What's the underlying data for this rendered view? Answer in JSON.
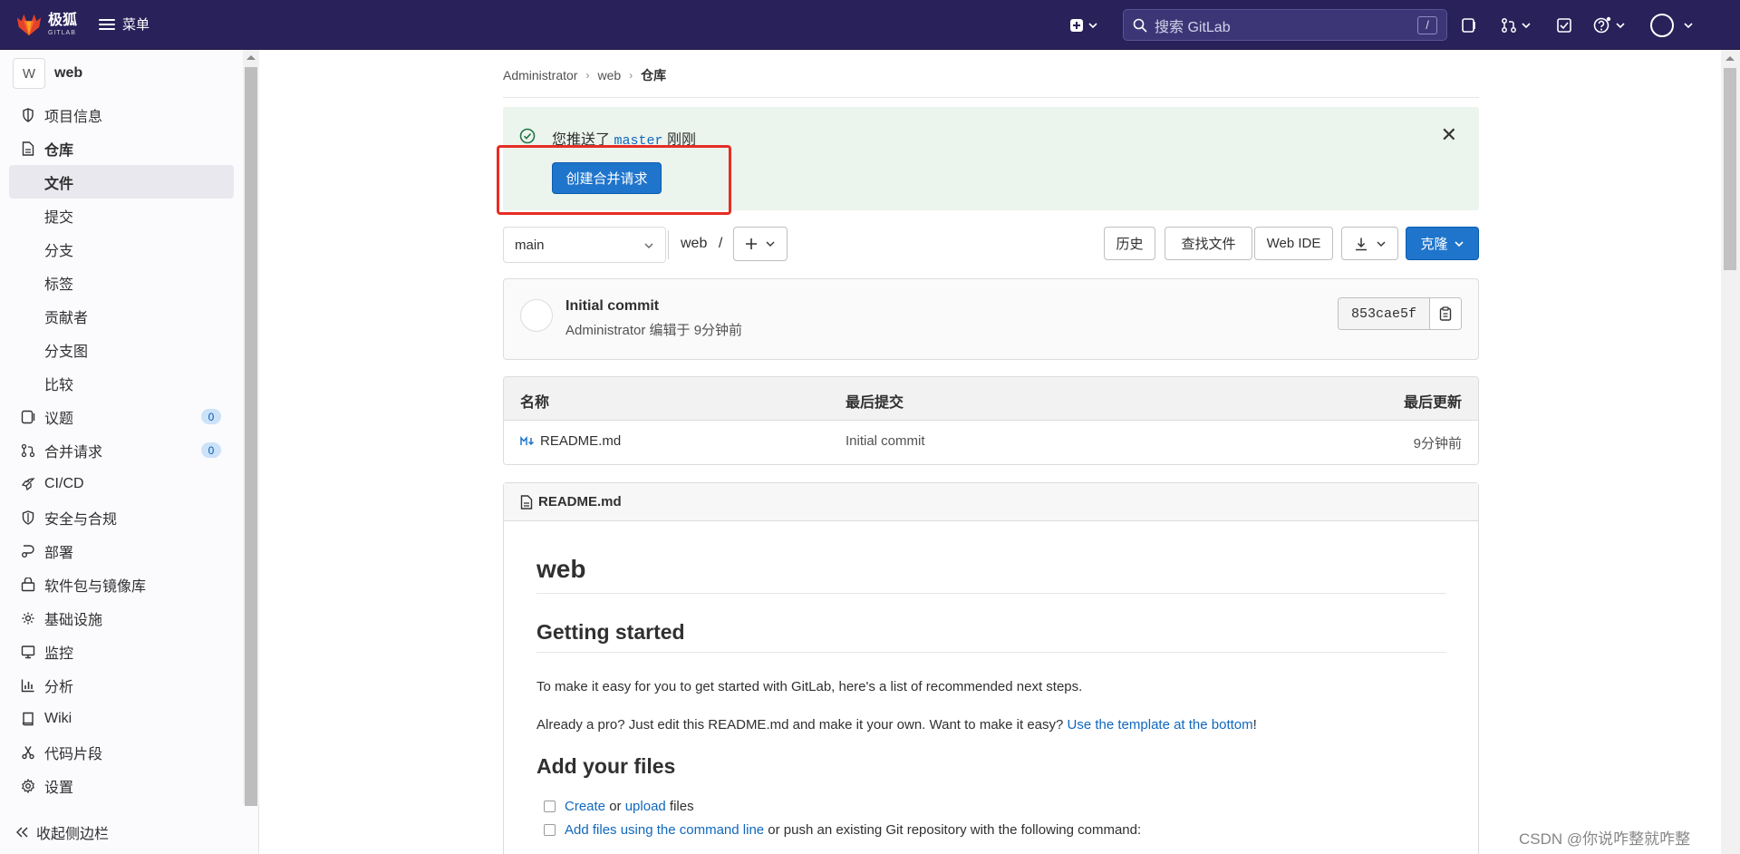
{
  "topnav": {
    "brand_cn": "极狐",
    "brand_en": "GITLAB",
    "menu_label": "菜单",
    "search_placeholder": "搜索 GitLab",
    "search_shortcut": "/",
    "bg_color": "#29215a"
  },
  "sidebar": {
    "project_initial": "W",
    "project_name": "web",
    "items": [
      {
        "label": "项目信息",
        "icon": "info-icon"
      },
      {
        "label": "仓库",
        "icon": "document-icon"
      },
      {
        "label": "文件",
        "active": true
      },
      {
        "label": "提交"
      },
      {
        "label": "分支"
      },
      {
        "label": "标签"
      },
      {
        "label": "贡献者"
      },
      {
        "label": "分支图"
      },
      {
        "label": "比较"
      },
      {
        "label": "议题",
        "icon": "issues-icon",
        "badge": "0"
      },
      {
        "label": "合并请求",
        "icon": "merge-request-icon",
        "badge": "0"
      },
      {
        "label": "CI/CD",
        "icon": "rocket-icon"
      },
      {
        "label": "安全与合规",
        "icon": "shield-icon"
      },
      {
        "label": "部署",
        "icon": "deploy-icon"
      },
      {
        "label": "软件包与镜像库",
        "icon": "package-icon"
      },
      {
        "label": "基础设施",
        "icon": "cloud-gear-icon"
      },
      {
        "label": "监控",
        "icon": "monitor-icon"
      },
      {
        "label": "分析",
        "icon": "chart-icon"
      },
      {
        "label": "Wiki",
        "icon": "book-icon"
      },
      {
        "label": "代码片段",
        "icon": "scissors-icon"
      },
      {
        "label": "设置",
        "icon": "gear-icon"
      }
    ],
    "collapse_label": "收起侧边栏"
  },
  "breadcrumb": [
    "Administrator",
    "web",
    "仓库"
  ],
  "alert": {
    "prefix": "您推送了",
    "branch": "master",
    "suffix": "刚刚",
    "button": "创建合并请求"
  },
  "toolbar": {
    "branch": "main",
    "path": "web",
    "path_sep": "/",
    "history": "历史",
    "find_file": "查找文件",
    "web_ide": "Web IDE",
    "clone": "克隆"
  },
  "commit": {
    "title": "Initial commit",
    "author": "Administrator",
    "meta": "编辑于 9分钟前",
    "sha": "853cae5f"
  },
  "file_table": {
    "headers": [
      "名称",
      "最后提交",
      "最后更新"
    ],
    "rows": [
      {
        "name": "README.md",
        "commit": "Initial commit",
        "updated": "9分钟前"
      }
    ]
  },
  "readme": {
    "filename": "README.md",
    "h1": "web",
    "h2_getting_started": "Getting started",
    "p1": "To make it easy for you to get started with GitLab, here's a list of recommended next steps.",
    "p2_text": "Already a pro? Just edit this README.md and make it your own. Want to make it easy? ",
    "p2_link": "Use the template at the bottom",
    "p2_end": "!",
    "h2_add_files": "Add your files",
    "task1_link1": "Create",
    "task1_or": " or ",
    "task1_link2": "upload",
    "task1_end": " files",
    "task2_link": "Add files using the command line",
    "task2_end": " or push an existing Git repository with the following command:"
  },
  "watermark": "CSDN @你说咋整就咋整"
}
